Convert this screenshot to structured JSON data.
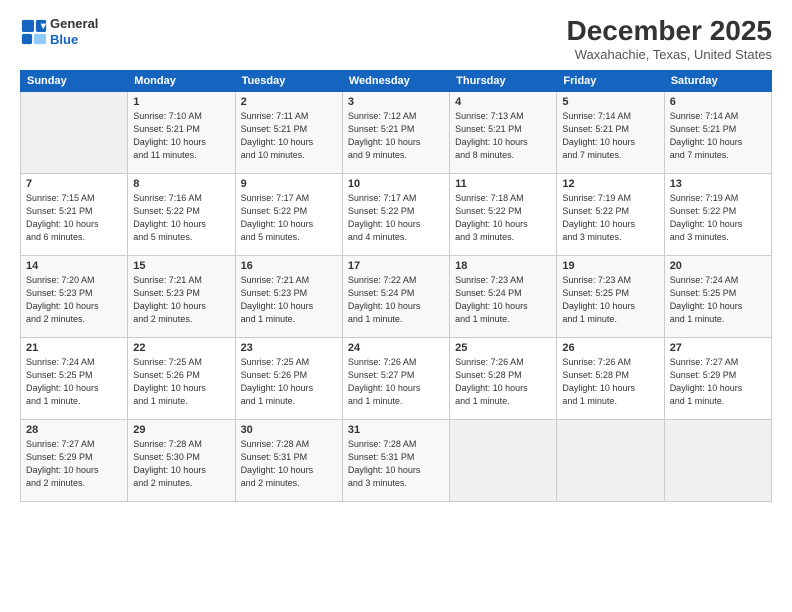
{
  "header": {
    "logo_line1": "General",
    "logo_line2": "Blue",
    "month": "December 2025",
    "location": "Waxahachie, Texas, United States"
  },
  "days_of_week": [
    "Sunday",
    "Monday",
    "Tuesday",
    "Wednesday",
    "Thursday",
    "Friday",
    "Saturday"
  ],
  "weeks": [
    [
      {
        "num": "",
        "info": ""
      },
      {
        "num": "1",
        "info": "Sunrise: 7:10 AM\nSunset: 5:21 PM\nDaylight: 10 hours\nand 11 minutes."
      },
      {
        "num": "2",
        "info": "Sunrise: 7:11 AM\nSunset: 5:21 PM\nDaylight: 10 hours\nand 10 minutes."
      },
      {
        "num": "3",
        "info": "Sunrise: 7:12 AM\nSunset: 5:21 PM\nDaylight: 10 hours\nand 9 minutes."
      },
      {
        "num": "4",
        "info": "Sunrise: 7:13 AM\nSunset: 5:21 PM\nDaylight: 10 hours\nand 8 minutes."
      },
      {
        "num": "5",
        "info": "Sunrise: 7:14 AM\nSunset: 5:21 PM\nDaylight: 10 hours\nand 7 minutes."
      },
      {
        "num": "6",
        "info": "Sunrise: 7:14 AM\nSunset: 5:21 PM\nDaylight: 10 hours\nand 7 minutes."
      }
    ],
    [
      {
        "num": "7",
        "info": "Sunrise: 7:15 AM\nSunset: 5:21 PM\nDaylight: 10 hours\nand 6 minutes."
      },
      {
        "num": "8",
        "info": "Sunrise: 7:16 AM\nSunset: 5:22 PM\nDaylight: 10 hours\nand 5 minutes."
      },
      {
        "num": "9",
        "info": "Sunrise: 7:17 AM\nSunset: 5:22 PM\nDaylight: 10 hours\nand 5 minutes."
      },
      {
        "num": "10",
        "info": "Sunrise: 7:17 AM\nSunset: 5:22 PM\nDaylight: 10 hours\nand 4 minutes."
      },
      {
        "num": "11",
        "info": "Sunrise: 7:18 AM\nSunset: 5:22 PM\nDaylight: 10 hours\nand 3 minutes."
      },
      {
        "num": "12",
        "info": "Sunrise: 7:19 AM\nSunset: 5:22 PM\nDaylight: 10 hours\nand 3 minutes."
      },
      {
        "num": "13",
        "info": "Sunrise: 7:19 AM\nSunset: 5:22 PM\nDaylight: 10 hours\nand 3 minutes."
      }
    ],
    [
      {
        "num": "14",
        "info": "Sunrise: 7:20 AM\nSunset: 5:23 PM\nDaylight: 10 hours\nand 2 minutes."
      },
      {
        "num": "15",
        "info": "Sunrise: 7:21 AM\nSunset: 5:23 PM\nDaylight: 10 hours\nand 2 minutes."
      },
      {
        "num": "16",
        "info": "Sunrise: 7:21 AM\nSunset: 5:23 PM\nDaylight: 10 hours\nand 1 minute."
      },
      {
        "num": "17",
        "info": "Sunrise: 7:22 AM\nSunset: 5:24 PM\nDaylight: 10 hours\nand 1 minute."
      },
      {
        "num": "18",
        "info": "Sunrise: 7:23 AM\nSunset: 5:24 PM\nDaylight: 10 hours\nand 1 minute."
      },
      {
        "num": "19",
        "info": "Sunrise: 7:23 AM\nSunset: 5:25 PM\nDaylight: 10 hours\nand 1 minute."
      },
      {
        "num": "20",
        "info": "Sunrise: 7:24 AM\nSunset: 5:25 PM\nDaylight: 10 hours\nand 1 minute."
      }
    ],
    [
      {
        "num": "21",
        "info": "Sunrise: 7:24 AM\nSunset: 5:25 PM\nDaylight: 10 hours\nand 1 minute."
      },
      {
        "num": "22",
        "info": "Sunrise: 7:25 AM\nSunset: 5:26 PM\nDaylight: 10 hours\nand 1 minute."
      },
      {
        "num": "23",
        "info": "Sunrise: 7:25 AM\nSunset: 5:26 PM\nDaylight: 10 hours\nand 1 minute."
      },
      {
        "num": "24",
        "info": "Sunrise: 7:26 AM\nSunset: 5:27 PM\nDaylight: 10 hours\nand 1 minute."
      },
      {
        "num": "25",
        "info": "Sunrise: 7:26 AM\nSunset: 5:28 PM\nDaylight: 10 hours\nand 1 minute."
      },
      {
        "num": "26",
        "info": "Sunrise: 7:26 AM\nSunset: 5:28 PM\nDaylight: 10 hours\nand 1 minute."
      },
      {
        "num": "27",
        "info": "Sunrise: 7:27 AM\nSunset: 5:29 PM\nDaylight: 10 hours\nand 1 minute."
      }
    ],
    [
      {
        "num": "28",
        "info": "Sunrise: 7:27 AM\nSunset: 5:29 PM\nDaylight: 10 hours\nand 2 minutes."
      },
      {
        "num": "29",
        "info": "Sunrise: 7:28 AM\nSunset: 5:30 PM\nDaylight: 10 hours\nand 2 minutes."
      },
      {
        "num": "30",
        "info": "Sunrise: 7:28 AM\nSunset: 5:31 PM\nDaylight: 10 hours\nand 2 minutes."
      },
      {
        "num": "31",
        "info": "Sunrise: 7:28 AM\nSunset: 5:31 PM\nDaylight: 10 hours\nand 3 minutes."
      },
      {
        "num": "",
        "info": ""
      },
      {
        "num": "",
        "info": ""
      },
      {
        "num": "",
        "info": ""
      }
    ]
  ]
}
